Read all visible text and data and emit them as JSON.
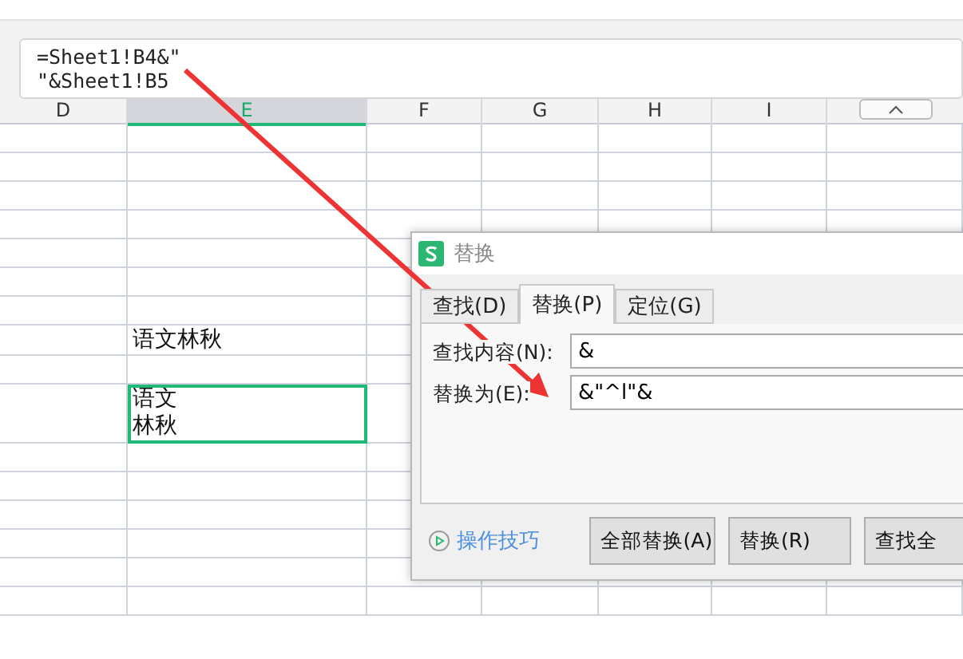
{
  "formula_bar": {
    "lines": [
      "=Sheet1!B4&\"",
      "\"&Sheet1!B5"
    ]
  },
  "columns": [
    {
      "label": "D",
      "selected": false
    },
    {
      "label": "E",
      "selected": true
    },
    {
      "label": "F",
      "selected": false
    },
    {
      "label": "G",
      "selected": false
    },
    {
      "label": "H",
      "selected": false
    },
    {
      "label": "I",
      "selected": false
    }
  ],
  "cells": [
    {
      "lines": [
        "语文林秋"
      ],
      "selected": false
    },
    {
      "lines": [
        "语文",
        "林秋"
      ],
      "selected": true
    }
  ],
  "dialog": {
    "title": "替换",
    "tabs": [
      {
        "label": "查找(D)",
        "selected": false
      },
      {
        "label": "替换(P)",
        "selected": true
      },
      {
        "label": "定位(G)",
        "selected": false
      }
    ],
    "fields": [
      {
        "label": "查找内容(N):",
        "value": "&"
      },
      {
        "label": "替换为(E):",
        "value": "&\"^l\"&"
      }
    ],
    "tips_link": "操作技巧",
    "buttons": [
      "全部替换(A)",
      "替换(R)",
      "查找全"
    ]
  }
}
